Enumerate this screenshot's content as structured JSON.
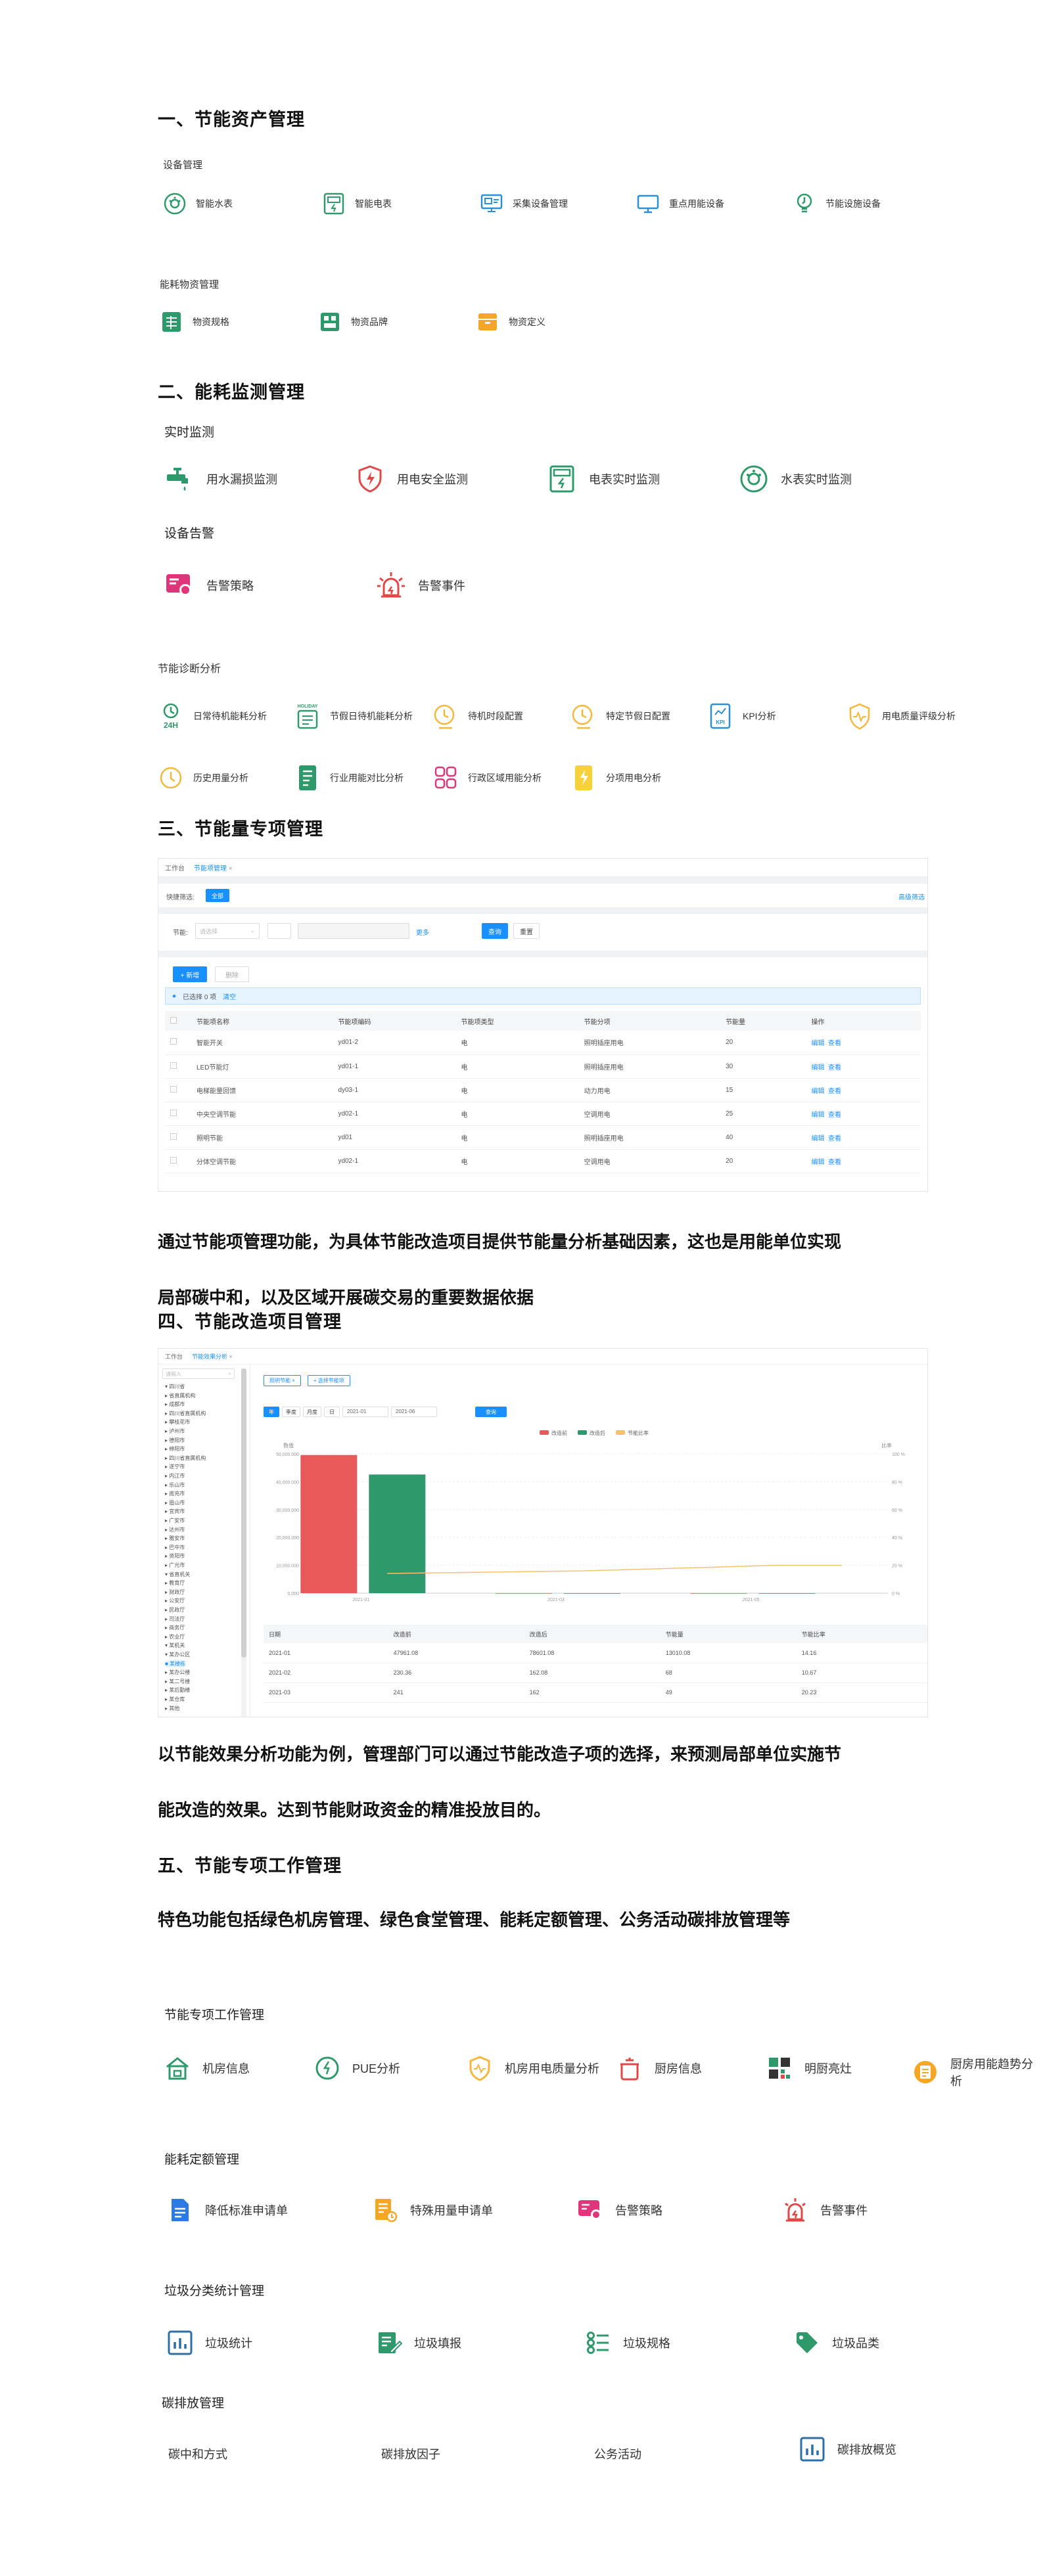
{
  "s1": {
    "title": "一、节能资产管理",
    "group1": {
      "label": "设备管理",
      "items": [
        "智能水表",
        "智能电表",
        "采集设备管理",
        "重点用能设备",
        "节能设施设备"
      ]
    },
    "group2": {
      "label": "能耗物资管理",
      "items": [
        "物资规格",
        "物资品牌",
        "物资定义"
      ]
    }
  },
  "s2": {
    "title": "二、能耗监测管理",
    "realtime": {
      "label": "实时监测",
      "items": [
        "用水漏损监测",
        "用电安全监测",
        "电表实时监测",
        "水表实时监测"
      ]
    },
    "alarm": {
      "label": "设备告警",
      "items": [
        "告警策略",
        "告警事件"
      ]
    },
    "diagnosis": {
      "label": "节能诊断分析",
      "row1": [
        "日常待机能耗分析",
        "节假日待机能耗分析",
        "待机时段配置",
        "特定节假日配置",
        "KPI分析",
        "用电质量评级分析"
      ],
      "row2": [
        "历史用量分析",
        "行业用能对比分析",
        "行政区域用能分析",
        "分项用电分析"
      ],
      "icon_texts": [
        "24H",
        "HOLIDAY",
        "KPI"
      ]
    }
  },
  "s3": {
    "title": "三、节能量专项管理",
    "screenshot": {
      "tabs": [
        "工作台",
        "节能项管理",
        "×"
      ],
      "quick_filter_label": "快捷筛选:",
      "quick_filter_all": "全部",
      "top_right_link": "高级筛选",
      "filter_label": "节能:",
      "filter_placeholder": "请选择",
      "filter_link": "更多",
      "query_btn": "查询",
      "reset_btn": "重置",
      "add_btn": "+ 新增",
      "delete_btn": "删除",
      "selected_info": "已选择 0 项",
      "clear_link": "清空",
      "columns": [
        "节能项名称",
        "节能项编码",
        "节能项类型",
        "节能分项",
        "节能量",
        "操作"
      ],
      "rows": [
        [
          "智能开关",
          "yd01-2",
          "电",
          "照明插座用电",
          "20"
        ],
        [
          "LED节能灯",
          "yd01-1",
          "电",
          "照明插座用电",
          "30"
        ],
        [
          "电梯能量回馈",
          "dy03-1",
          "电",
          "动力用电",
          "15"
        ],
        [
          "中央空调节能",
          "yd02-1",
          "电",
          "空调用电",
          "25"
        ],
        [
          "照明节能",
          "yd01",
          "电",
          "照明插座用电",
          "40"
        ],
        [
          "分体空调节能",
          "yd02-1",
          "电",
          "空调用电",
          "20"
        ]
      ],
      "edit_label": "编辑",
      "view_label": "查看"
    },
    "para_line1": "通过节能项管理功能，为具体节能改造项目提供节能量分析基础因素，这也是用能单位实现",
    "para_line2": "局部碳中和，以及区域开展碳交易的重要数据依据"
  },
  "s4": {
    "title": "四、节能改造项目管理",
    "screenshot": {
      "tabs": [
        "工作台",
        "节能效果分析",
        "×"
      ],
      "search_placeholder": "请输入",
      "tree": [
        "▾ 四川省",
        "▸ 省直属机构",
        "▸ 成都市",
        "▸ 四川省直属机构",
        "▸ 攀枝花市",
        "▸ 泸州市",
        "▸ 德阳市",
        "▸ 绵阳市",
        "▸ 四川省直属机构",
        "▸ 遂宁市",
        "▸ 内江市",
        "▸ 乐山市",
        "▸ 南充市",
        "▸ 眉山市",
        "▸ 宜宾市",
        "▸ 广安市",
        "▸ 达州市",
        "▸ 雅安市",
        "▸ 巴中市",
        "▸ 资阳市",
        "▸ 广元市",
        "▾ 省直机关",
        "  ▸ 教育厅",
        "  ▸ 财政厅",
        "  ▸ 公安厅",
        "  ▸ 民政厅",
        "  ▸ 司法厅",
        "  ▸ 商务厅",
        "  ▸ 农业厅",
        "  ▾ 某机关",
        "    ▾ 某办公区",
        "      ■ 某楼栋",
        "      ▸ 某办公楼",
        "      ▸ 某二号楼",
        "      ▸ 某后勤楼",
        "    ▸ 某仓库",
        "  ▸ 其他"
      ],
      "filter_tags": [
        "照明节能 ×",
        "+ 选择节能项"
      ],
      "period_tabs": [
        "年",
        "季度",
        "月度",
        "日"
      ],
      "date_start": "2021-01",
      "date_end": "2021-06",
      "query_btn": "查询",
      "legend": [
        "改造前",
        "改造后",
        "节能比率"
      ],
      "yleft_label": "数值",
      "yright_label": "比率",
      "yticks": [
        "50,000.000",
        "40,000.000",
        "30,000.000",
        "20,000.000",
        "10,000.000",
        "0.000"
      ],
      "yticks_right": [
        "100 %",
        "80 %",
        "60 %",
        "40 %",
        "20 %",
        "0 %"
      ],
      "xlabels": [
        "2021-01",
        "2021-03",
        "2021-05"
      ],
      "columns": [
        "日期",
        "改造前",
        "改造后",
        "节能量",
        "节能比率"
      ],
      "rows": [
        [
          "2021-01",
          "47961.08",
          "78601.08",
          "13010.08",
          "14.16"
        ],
        [
          "2021-02",
          "230.36",
          "162.08",
          "68",
          "10.67"
        ],
        [
          "2021-03",
          "241",
          "162",
          "49",
          "20.23"
        ]
      ]
    },
    "chart_data": {
      "type": "bar",
      "categories": [
        "2021-01",
        "2021-03",
        "2021-05"
      ],
      "series": [
        {
          "name": "改造前",
          "values": [
            49600,
            0,
            0
          ]
        },
        {
          "name": "改造后",
          "values": [
            42600,
            0,
            0
          ]
        },
        {
          "name": "节能比率",
          "values": [
            14.16,
            16,
            20
          ]
        }
      ],
      "ylim": [
        0,
        50000
      ],
      "legend": "top"
    },
    "colors": {
      "before": "#e85a5a",
      "after": "#2e9a6b",
      "ratio": "#f5c26b"
    },
    "para_line1": "以节能效果分析功能为例，管理部门可以通过节能改造子项的选择，来预测局部单位实施节",
    "para_line2": "能改造的效果。达到节能财政资金的精准投放目的。"
  },
  "s5": {
    "title": "五、节能专项工作管理",
    "para": "特色功能包括绿色机房管理、绿色食堂管理、能耗定额管理、公务活动碳排放管理等",
    "g1": {
      "label": "节能专项工作管理",
      "items": [
        "机房信息",
        "PUE分析",
        "机房用电质量分析",
        "厨房信息",
        "明厨亮灶",
        "厨房用能趋势分析"
      ]
    },
    "g2": {
      "label": "能耗定额管理",
      "items": [
        "降低标准申请单",
        "特殊用量申请单",
        "告警策略",
        "告警事件"
      ]
    },
    "g3": {
      "label": "垃圾分类统计管理",
      "items": [
        "垃圾统计",
        "垃圾填报",
        "垃圾规格",
        "垃圾品类"
      ]
    },
    "g4": {
      "label": "碳排放管理",
      "items": [
        "碳中和方式",
        "碳排放因子",
        "公务活动",
        "碳排放概览"
      ]
    }
  }
}
